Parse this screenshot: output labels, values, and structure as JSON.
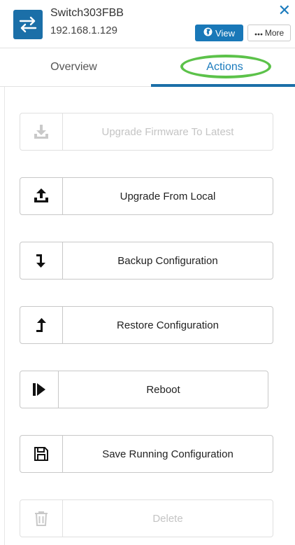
{
  "device": {
    "name": "Switch303FBB",
    "ip": "192.168.1.129"
  },
  "header": {
    "close_symbol": "✕",
    "view_label": "View",
    "more_label": "More"
  },
  "tabs": [
    {
      "label": "Overview",
      "active": false
    },
    {
      "label": "Actions",
      "active": true
    }
  ],
  "colors": {
    "accent": "#1b6fa8",
    "highlight_ring": "#5cc24a",
    "disabled_text": "#c4c4c4"
  },
  "actions": [
    {
      "label": "Upgrade Firmware To Latest",
      "icon": "download-icon",
      "enabled": false
    },
    {
      "label": "Upgrade From Local",
      "icon": "upload-icon",
      "enabled": true
    },
    {
      "label": "Backup Configuration",
      "icon": "arrow-down-icon",
      "enabled": true
    },
    {
      "label": "Restore Configuration",
      "icon": "arrow-up-icon",
      "enabled": true
    },
    {
      "label": "Reboot",
      "icon": "reboot-icon",
      "enabled": true
    },
    {
      "label": "Save Running Configuration",
      "icon": "floppy-disk-icon",
      "enabled": true
    },
    {
      "label": "Delete",
      "icon": "trash-icon",
      "enabled": false
    }
  ]
}
